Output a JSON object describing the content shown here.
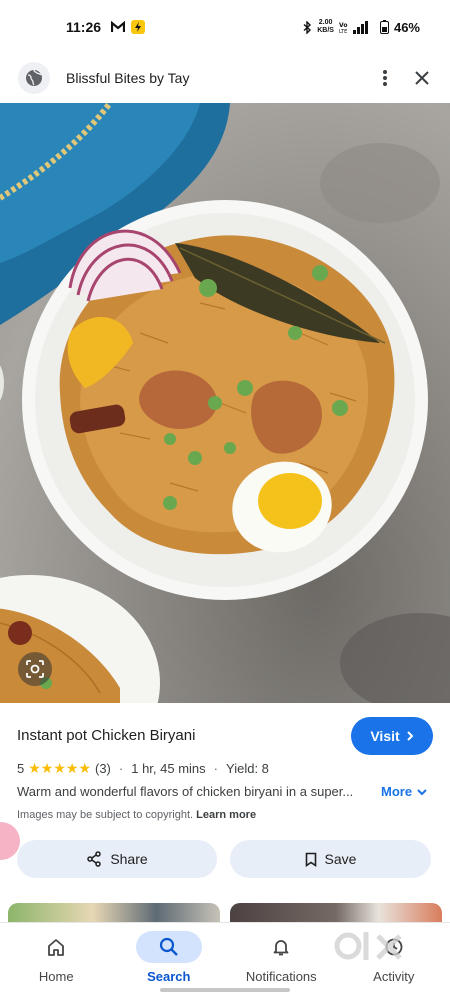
{
  "status_bar": {
    "time": "11:26",
    "left_icons": [
      "gmail-m-icon",
      "lightning-app-icon"
    ],
    "net_speed_top": "2.00",
    "net_speed_bottom": "KB/S",
    "battery": "46%"
  },
  "header": {
    "site_title": "Blissful Bites by Tay",
    "icons": [
      "globe-icon",
      "more-vert-icon",
      "close-icon"
    ]
  },
  "result": {
    "title": "Instant pot Chicken Biryani",
    "visit_label": "Visit",
    "rating": "5",
    "stars": "★★★★★",
    "rating_count": "(3)",
    "time": "1 hr, 45 mins",
    "yield": "Yield: 8",
    "description": "Warm and wonderful flavors of chicken biryani in a super...",
    "more_label": "More",
    "copyright_text": "Images may be subject to copyright.",
    "learn_more": "Learn more",
    "share_label": "Share",
    "save_label": "Save"
  },
  "bottom_nav": {
    "items": [
      {
        "label": "Home",
        "icon": "home-icon"
      },
      {
        "label": "Search",
        "icon": "search-icon"
      },
      {
        "label": "Notifications",
        "icon": "bell-icon"
      },
      {
        "label": "Activity",
        "icon": "activity-icon"
      }
    ],
    "active": "Search"
  },
  "colors": {
    "accent": "#1a73e8",
    "nav_active_bg": "#d3e3fd",
    "star": "#fbbc04",
    "action_bg": "#e8eef8"
  }
}
